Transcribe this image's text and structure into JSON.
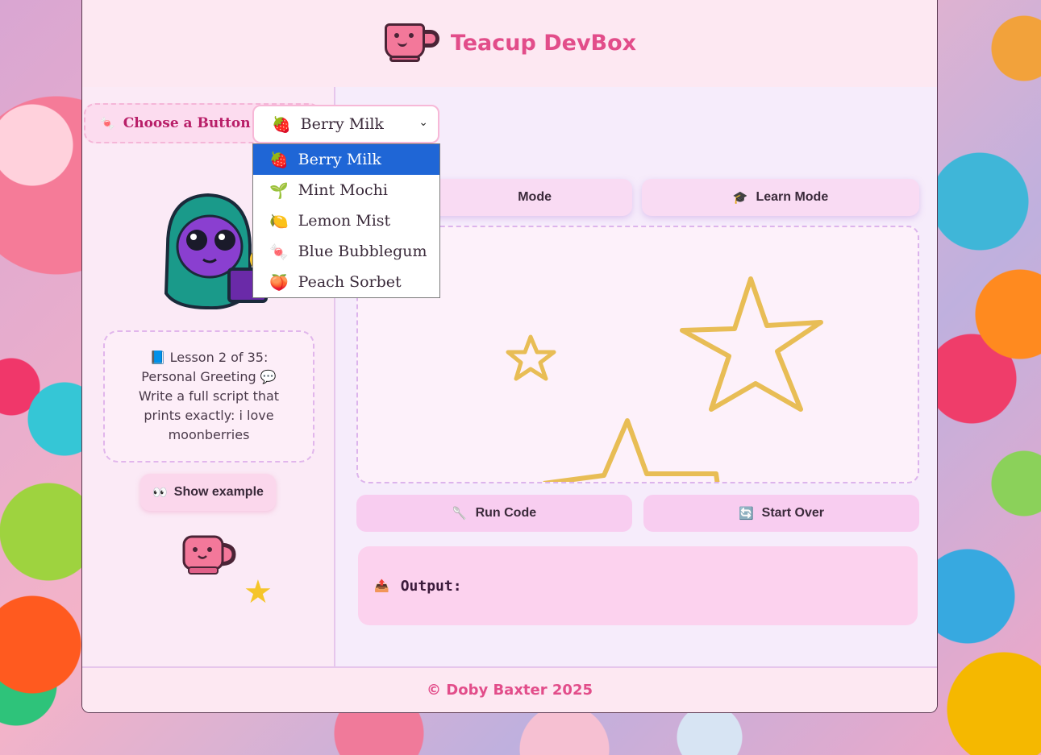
{
  "header": {
    "title": "Teacup DevBox",
    "logo_icon": "teacup-icon"
  },
  "theme": {
    "label": "Choose a Button Theme:",
    "label_icon": "candy-icon",
    "selected": "Berry Milk",
    "selected_icon": "🍓",
    "options": [
      {
        "icon": "🍓",
        "label": "Berry Milk"
      },
      {
        "icon": "🌱",
        "label": "Mint Mochi"
      },
      {
        "icon": "🍋",
        "label": "Lemon Mist"
      },
      {
        "icon": "🍬",
        "label": "Blue Bubblegum"
      },
      {
        "icon": "🍑",
        "label": "Peach Sorbet"
      }
    ]
  },
  "lesson": {
    "icon": "📘",
    "line1": "Lesson 2 of 35:",
    "line2": "Personal Greeting",
    "line2_icon": "💬",
    "line3": "Write a full script that prints exactly: i love moonberries"
  },
  "show_example": {
    "label": "Show example",
    "icon": "👀"
  },
  "modes": [
    {
      "label": "Mode",
      "icon": ""
    },
    {
      "label": "Learn Mode",
      "icon": "🎓"
    }
  ],
  "actions": {
    "run": {
      "label": "Run Code",
      "icon": "🥄"
    },
    "start_over": {
      "label": "Start Over",
      "icon": "🔄"
    }
  },
  "output": {
    "label": "Output:",
    "icon": "📤"
  },
  "footer": {
    "text": "© Doby Baxter 2025"
  },
  "colors": {
    "accent": "#e24d8a",
    "dropdown_selected": "#1f66d6",
    "star": "#e8bd55"
  }
}
